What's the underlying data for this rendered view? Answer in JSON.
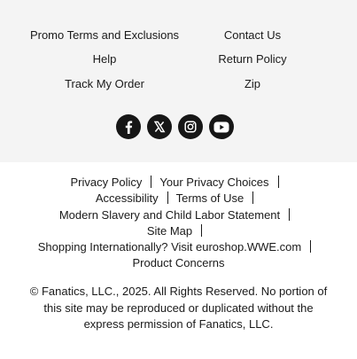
{
  "help_links": {
    "promo": "Promo Terms and Exclusions",
    "contact": "Contact Us",
    "help": "Help",
    "return_policy": "Return Policy",
    "track_order": "Track My Order",
    "zip": "Zip"
  },
  "social": {
    "icons": [
      "facebook-icon",
      "x-icon",
      "instagram-icon",
      "youtube-icon"
    ],
    "background": "#161616"
  },
  "legal_links": {
    "privacy_policy": "Privacy Policy",
    "privacy_choices": "Your Privacy Choices",
    "accessibility": "Accessibility",
    "terms": "Terms of Use",
    "slavery": "Modern Slavery and Child Labor Statement",
    "site_map": "Site Map",
    "international": "Shopping Internationally? Visit euroshop.WWE.com",
    "product_concerns": "Product Concerns"
  },
  "copyright": "© Fanatics, LLC., 2025. All Rights Reserved. No portion of this site may be reproduced or duplicated without the express permission of Fanatics, LLC.",
  "colors": {
    "top_background": "#f4f4f4",
    "bottom_background": "#ffffff",
    "text": "#1a1a1a"
  }
}
